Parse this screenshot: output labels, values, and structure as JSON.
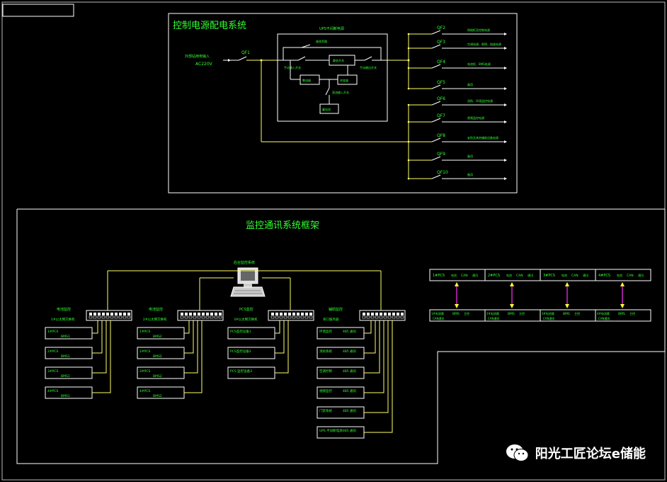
{
  "colors": {
    "background": "#000000",
    "frame": "#ffffff",
    "wire": "#ffff66",
    "text": "#33ff33",
    "link": "#ff33ff"
  },
  "power": {
    "title": "控制电源配电系统",
    "ups_title": "UPS不间断电源",
    "input_label1": "外部站用电输入",
    "input_label2": "AC220V",
    "qf1": "QF1",
    "bypass_label": "维修旁路",
    "manual_bypass": "手动输入开关",
    "static_switch": "静态开关",
    "rectifier": "整流器",
    "inverter": "逆变器",
    "output_switch": "手动输出开关",
    "battery_switch": "直流输入开关",
    "battery": "蓄电池",
    "outputs": [
      {
        "id": "QF2",
        "label": "网络柜及控制电源"
      },
      {
        "id": "QF3",
        "label": "空调电源、照明、插座电源"
      },
      {
        "id": "QF4",
        "label": "电池柜、BMS电源"
      },
      {
        "id": "QF5",
        "label": "备用"
      },
      {
        "id": "QF6",
        "label": "消防、环境监控电源"
      },
      {
        "id": "QF7",
        "label": "视频监控电源"
      },
      {
        "id": "QF8",
        "label": "安防及其他辅助设备电源"
      },
      {
        "id": "QF9",
        "label": "备用"
      },
      {
        "id": "QF10",
        "label": "备用"
      }
    ]
  },
  "comm": {
    "title": "监控通讯系统框架",
    "computer_label": "后台监控系统",
    "groups": [
      {
        "title1": "电池监控",
        "title2": "1#以太网交换机",
        "items": [
          [
            "1#PCS",
            "BMS1"
          ],
          [
            "2#PCS",
            "BMS1"
          ],
          [
            "3#PCS",
            "BMS1"
          ],
          [
            "4#PCS",
            "BMS1"
          ]
        ]
      },
      {
        "title1": "电池监控",
        "title2": "2#以太网交换机",
        "items": [
          [
            "1#PCS",
            "BMS2"
          ],
          [
            "2#PCS",
            "BMS2"
          ],
          [
            "3#PCS",
            "BMS2"
          ],
          [
            "4#PCS",
            "BMS2"
          ]
        ]
      },
      {
        "title1": "PCS监控",
        "title2": "3#以太网交换机",
        "items": [
          [
            "PCS监控设备1",
            ""
          ],
          [
            "PCS监控设备2",
            ""
          ],
          [
            "PCS  监控设备3",
            ""
          ]
        ]
      },
      {
        "title1": "辅助监控",
        "title2": "串口服务器",
        "items": [
          [
            "环境监控",
            "485  通讯"
          ],
          [
            "消防系统",
            "485  通讯"
          ],
          [
            "空调控制",
            "485  通讯"
          ],
          [
            "视频监控",
            "485  通讯"
          ],
          [
            "门禁系统",
            "485  通讯"
          ],
          [
            "UPS  不间断电源",
            "485  通讯"
          ]
        ]
      }
    ],
    "pcs_top": [
      [
        "1#PCS",
        "电池",
        "CAN",
        "通讯"
      ],
      [
        "2#PCS",
        "电池",
        "CAN",
        "通讯"
      ],
      [
        "3#PCS",
        "电池",
        "CAN",
        "通讯"
      ],
      [
        "4#PCS",
        "电池",
        "CAN",
        "通讯"
      ]
    ],
    "pcs_bottom": [
      [
        "1#电池簇",
        "BMS",
        "主控",
        "CAN通讯"
      ],
      [
        "2#电池簇",
        "BMS",
        "主控",
        "CAN通讯"
      ],
      [
        "3#电池簇",
        "BMS",
        "主控",
        "CAN通讯"
      ],
      [
        "4#电池簇",
        "BMS",
        "主控",
        "CAN通讯"
      ]
    ]
  },
  "watermark": "阳光工匠论坛e储能"
}
